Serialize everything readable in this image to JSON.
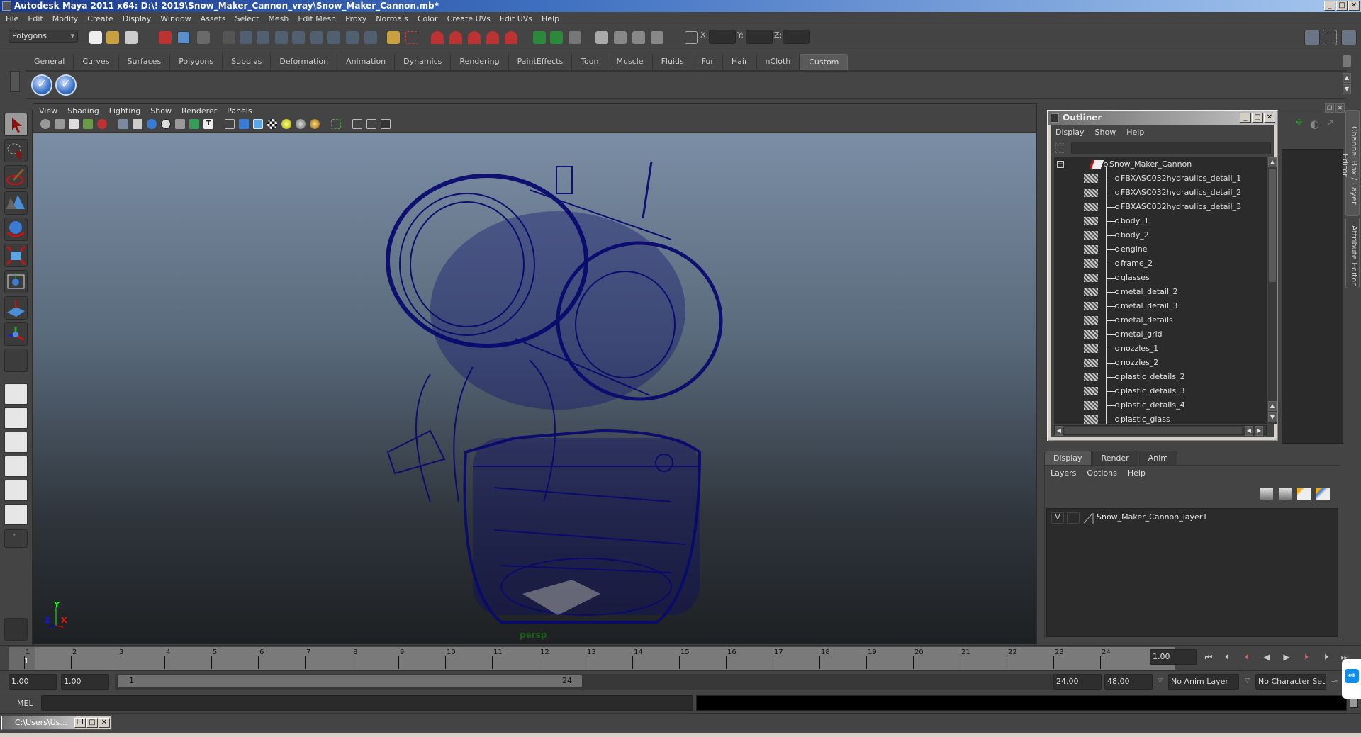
{
  "window": {
    "title": "Autodesk Maya 2011 x64: D:\\! 2019\\Snow_Maker_Cannon_vray\\Snow_Maker_Cannon.mb*",
    "minimize": "_",
    "maximize": "□",
    "close": "✕"
  },
  "menubar": [
    "File",
    "Edit",
    "Modify",
    "Create",
    "Display",
    "Window",
    "Assets",
    "Select",
    "Mesh",
    "Edit Mesh",
    "Proxy",
    "Normals",
    "Color",
    "Create UVs",
    "Edit UVs",
    "Help"
  ],
  "statusline": {
    "mode": "Polygons",
    "x_label": "X:",
    "y_label": "Y:",
    "z_label": "Z:",
    "x_value": "",
    "y_value": "",
    "z_value": ""
  },
  "shelf": {
    "tabs": [
      "General",
      "Curves",
      "Surfaces",
      "Polygons",
      "Subdivs",
      "Deformation",
      "Animation",
      "Dynamics",
      "Rendering",
      "PaintEffects",
      "Toon",
      "Muscle",
      "Fluids",
      "Fur",
      "Hair",
      "nCloth",
      "Custom"
    ],
    "active_tab": "Custom",
    "buttons": [
      "check-script-button-1",
      "check-script-button-2"
    ]
  },
  "toolbox": {
    "tools": [
      "select-tool",
      "lasso-tool",
      "paint-select-tool",
      "last-tool",
      "rotate-tool",
      "scale-tool",
      "universal-manipulator",
      "soft-mod-tool",
      "move-tool",
      "empty-slot"
    ],
    "layouts": [
      "single-perspective-layout",
      "four-view-layout",
      "outliner-persp-layout",
      "persp-graph-layout",
      "hypershade-persp-layout",
      "persp-graph-hypergraph-layout"
    ]
  },
  "viewport": {
    "menus": [
      "View",
      "Shading",
      "Lighting",
      "Show",
      "Renderer",
      "Panels"
    ],
    "camera_label": "persp",
    "axis": {
      "x": "X",
      "y": "Y",
      "z": "Z"
    },
    "colors": {
      "wireframe": "#0a0a6e",
      "bg_top": "#7b8ea5",
      "bg_bottom": "#1e2022"
    }
  },
  "outliner": {
    "title": "Outliner",
    "menus": [
      "Display",
      "Show",
      "Help"
    ],
    "filter_value": "",
    "root": "Snow_Maker_Cannon",
    "children": [
      "FBXASC032hydraulics_detail_1",
      "FBXASC032hydraulics_detail_2",
      "FBXASC032hydraulics_detail_3",
      "body_1",
      "body_2",
      "engine",
      "frame_2",
      "glasses",
      "metal_detail_2",
      "metal_detail_3",
      "metal_details",
      "metal_grid",
      "nozzles_1",
      "nozzles_2",
      "plastic_details_2",
      "plastic_details_3",
      "plastic_details_4",
      "plastic_glass"
    ]
  },
  "side_tabs": [
    "Channel Box / Layer Editor",
    "Attribute Editor"
  ],
  "layer_editor": {
    "tabs": [
      "Display",
      "Render",
      "Anim"
    ],
    "active_tab": "Display",
    "menus": [
      "Layers",
      "Options",
      "Help"
    ],
    "layers": [
      {
        "visible": "V",
        "template": "",
        "name": "Snow_Maker_Cannon_layer1"
      }
    ]
  },
  "timeline": {
    "frames": [
      "1",
      "2",
      "3",
      "4",
      "5",
      "6",
      "7",
      "8",
      "9",
      "10",
      "11",
      "12",
      "13",
      "14",
      "15",
      "16",
      "17",
      "18",
      "19",
      "20",
      "21",
      "22",
      "23",
      "24"
    ],
    "current_frame_marker": "1",
    "current_frame": "1.00"
  },
  "range": {
    "start_time": "1.00",
    "playback_start": "1.00",
    "slider_start": "1",
    "slider_end": "24",
    "playback_end": "24.00",
    "end_time": "48.00",
    "anim_layer": "No Anim Layer",
    "character_set": "No Character Set"
  },
  "command_line": {
    "label": "MEL",
    "input": "",
    "output": ""
  },
  "taskbar": {
    "minimized_window": "C:\\Users\\Us..."
  }
}
